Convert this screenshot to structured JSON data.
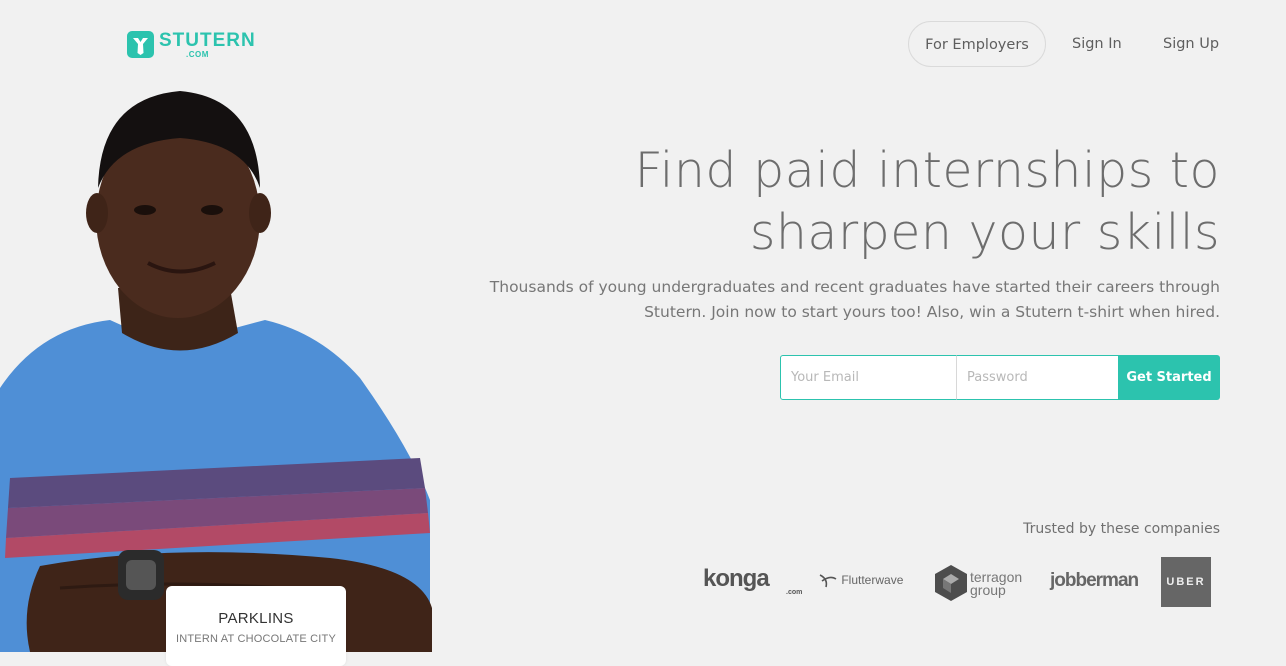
{
  "brand": {
    "name": "STUTERN",
    "suffix": ".COM"
  },
  "nav": {
    "employers": "For Employers",
    "signin": "Sign In",
    "signup": "Sign Up"
  },
  "hero": {
    "headline_line1": "Find paid internships to",
    "headline_line2": "sharpen your skills",
    "subtext_line1": "Thousands of young undergraduates and recent graduates have started their careers through",
    "subtext_line2": "Stutern. Join now to start yours too! Also, win a Stutern t-shirt when hired."
  },
  "form": {
    "email_placeholder": "Your Email",
    "password_placeholder": "Password",
    "submit_label": "Get Started"
  },
  "caption": {
    "name": "PARKLINS",
    "role": "INTERN AT CHOCOLATE CITY"
  },
  "trusted": {
    "heading": "Trusted by these companies",
    "companies": [
      "konga",
      "Flutterwave",
      "terragon group",
      "jobberman",
      "UBER"
    ]
  },
  "colors": {
    "accent": "#2cc3ae",
    "background": "#f1f1f1"
  }
}
